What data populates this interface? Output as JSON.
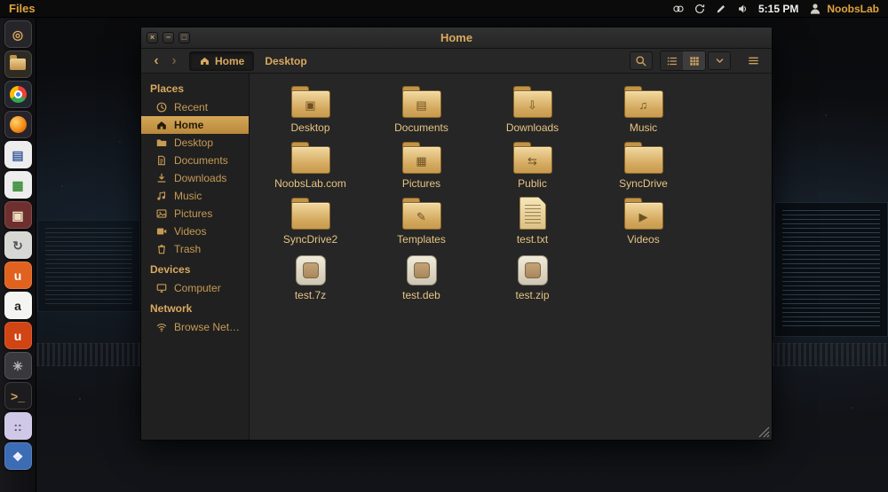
{
  "colors": {
    "accent": "#d9a95f",
    "panel_bg": "#0b0b0b",
    "selection": "#c79a4e"
  },
  "panel": {
    "app_menu": "Files",
    "time": "5:15 PM",
    "user": "NoobsLab",
    "status_icons": [
      "circles",
      "sync",
      "pencil",
      "speaker"
    ]
  },
  "dock": {
    "items": [
      {
        "name": "dash",
        "glyph": "◎",
        "bg": "#26262a",
        "fg": "#d9a95f"
      },
      {
        "name": "files",
        "special": "folder",
        "bg": "#2e2a24"
      },
      {
        "name": "chrome",
        "special": "chrome",
        "bg": "#23262e"
      },
      {
        "name": "firefox",
        "special": "firefox",
        "bg": "#26232b"
      },
      {
        "name": "writer",
        "glyph": "▤",
        "bg": "#ededed",
        "fg": "#3f5e9e"
      },
      {
        "name": "calc",
        "glyph": "▦",
        "bg": "#ededed",
        "fg": "#3d8f3d"
      },
      {
        "name": "impress",
        "glyph": "▣",
        "bg": "#6e2f2f",
        "fg": "#f0e0c0"
      },
      {
        "name": "updater",
        "glyph": "↻",
        "bg": "#d7d7d3",
        "fg": "#555555"
      },
      {
        "name": "software-center",
        "glyph": "u",
        "bg": "#e0621e",
        "fg": "#ffffff"
      },
      {
        "name": "amazon",
        "glyph": "a",
        "bg": "#f4f4f2",
        "fg": "#222222"
      },
      {
        "name": "ubuntu-one",
        "glyph": "u",
        "bg": "#d14413",
        "fg": "#ffffff"
      },
      {
        "name": "settings",
        "glyph": "✳",
        "bg": "#39393d",
        "fg": "#b9b9b9"
      },
      {
        "name": "terminal",
        "glyph": ">_",
        "bg": "#1c1c1f",
        "fg": "#cda05e"
      },
      {
        "name": "tweak",
        "glyph": "::",
        "bg": "#cfc8e6",
        "fg": "#5a5470"
      },
      {
        "name": "workspace",
        "glyph": "❖",
        "bg": "#3c6cb4",
        "fg": "#eeeeff"
      }
    ]
  },
  "window": {
    "title": "Home",
    "controls": {
      "close": "×",
      "minimize": "−",
      "maximize": "□"
    },
    "nav": {
      "back": "‹",
      "forward": "›"
    },
    "breadcrumbs": [
      {
        "label": "Home",
        "icon": "home",
        "current": true
      },
      {
        "label": "Desktop"
      }
    ],
    "sidebar": {
      "sections": [
        {
          "title": "Places",
          "items": [
            {
              "label": "Recent",
              "icon": "recent"
            },
            {
              "label": "Home",
              "icon": "home",
              "selected": true
            },
            {
              "label": "Desktop",
              "icon": "folder"
            },
            {
              "label": "Documents",
              "icon": "document"
            },
            {
              "label": "Downloads",
              "icon": "downloads"
            },
            {
              "label": "Music",
              "icon": "music"
            },
            {
              "label": "Pictures",
              "icon": "pictures"
            },
            {
              "label": "Videos",
              "icon": "videos"
            },
            {
              "label": "Trash",
              "icon": "trash"
            }
          ]
        },
        {
          "title": "Devices",
          "items": [
            {
              "label": "Computer",
              "icon": "computer"
            }
          ]
        },
        {
          "title": "Network",
          "items": [
            {
              "label": "Browse Net…",
              "icon": "network"
            }
          ]
        }
      ]
    },
    "files": [
      {
        "label": "Desktop",
        "type": "folder",
        "emblem": "desktop"
      },
      {
        "label": "Documents",
        "type": "folder",
        "emblem": "documents"
      },
      {
        "label": "Downloads",
        "type": "folder",
        "emblem": "downloads"
      },
      {
        "label": "Music",
        "type": "folder",
        "emblem": "music"
      },
      {
        "label": "NoobsLab.com",
        "type": "folder"
      },
      {
        "label": "Pictures",
        "type": "folder",
        "emblem": "pictures"
      },
      {
        "label": "Public",
        "type": "folder",
        "emblem": "public"
      },
      {
        "label": "SyncDrive",
        "type": "folder"
      },
      {
        "label": "SyncDrive2",
        "type": "folder"
      },
      {
        "label": "Templates",
        "type": "folder",
        "emblem": "templates"
      },
      {
        "label": "test.txt",
        "type": "textfile"
      },
      {
        "label": "Videos",
        "type": "folder",
        "emblem": "videos"
      },
      {
        "label": "test.7z",
        "type": "archive"
      },
      {
        "label": "test.deb",
        "type": "archive"
      },
      {
        "label": "test.zip",
        "type": "archive"
      }
    ]
  }
}
